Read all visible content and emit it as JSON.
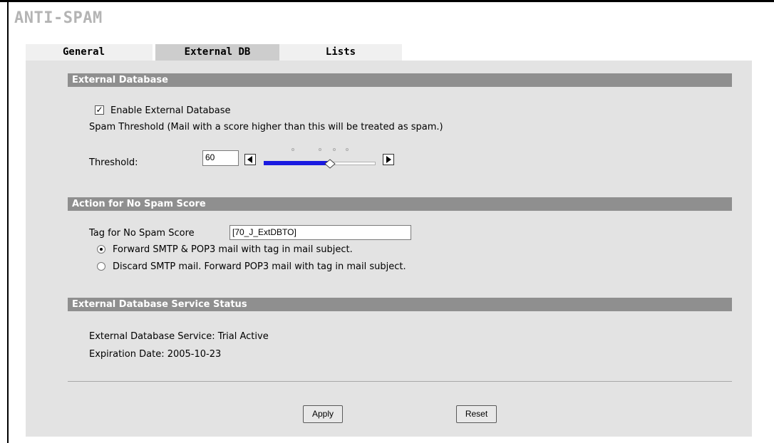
{
  "page": {
    "title": "ANTI-SPAM"
  },
  "tabs": [
    {
      "label": "General",
      "active": false
    },
    {
      "label": "External DB",
      "active": true
    },
    {
      "label": "Lists",
      "active": false
    }
  ],
  "external_db": {
    "header": "External Database",
    "enable_label": "Enable External Database",
    "enable_checked": true,
    "threshold_desc": "Spam Threshold (Mail with a score higher than this will be treated as spam.)",
    "threshold_label": "Threshold:",
    "threshold_value": "60",
    "slider_level_percent": 60
  },
  "no_spam_score": {
    "header": "Action for No Spam Score",
    "tag_label": "Tag for No Spam Score",
    "tag_value": "[70_J_ExtDBTO]",
    "options": [
      {
        "label": "Forward SMTP & POP3 mail with tag in mail subject.",
        "selected": true
      },
      {
        "label": "Discard SMTP mail. Forward POP3 mail with tag in mail subject.",
        "selected": false
      }
    ]
  },
  "service_status": {
    "header": "External Database Service Status",
    "service_line": "External Database Service: Trial Active",
    "expiration_line": "Expiration Date: 2005-10-23"
  },
  "buttons": {
    "apply": "Apply",
    "reset": "Reset"
  },
  "colors": {
    "slider_fill": "#1a1ae0",
    "section_bar": "#8f8f8f",
    "panel": "#e3e3e3"
  }
}
